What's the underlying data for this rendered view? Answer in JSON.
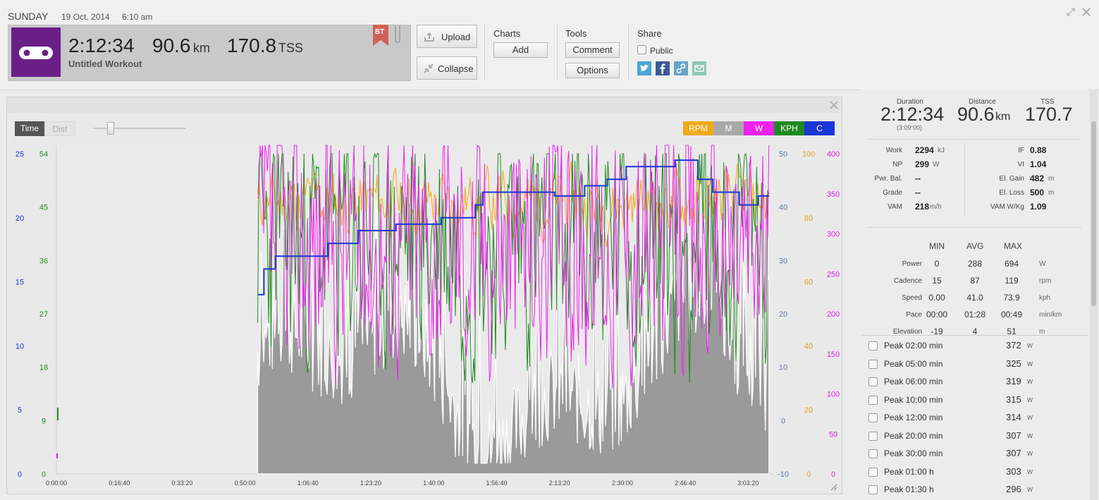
{
  "header": {
    "day": "SUNDAY",
    "date": "19 Oct, 2014",
    "time": "6:10 am",
    "duration": "2:12:34",
    "distance": "90.6",
    "distance_unit": "km",
    "tss": "170.8",
    "tss_unit": "TSS",
    "workout_title": "Untitled Workout",
    "bt_badge": "BT",
    "upload_label": "Upload",
    "collapse_label": "Collapse",
    "charts_title": "Charts",
    "add_label": "Add",
    "tools_title": "Tools",
    "comment_label": "Comment",
    "options_label": "Options",
    "share_title": "Share",
    "public_label": "Public",
    "share_icons": [
      "twitter-icon",
      "facebook-icon",
      "link-icon",
      "email-icon"
    ]
  },
  "chart": {
    "toggle_time": "Time",
    "toggle_dist": "Dist",
    "legend": [
      {
        "label": "RPM",
        "color": "#f2a818"
      },
      {
        "label": "M",
        "color": "#a9a9a9"
      },
      {
        "label": "W",
        "color": "#ee22ee"
      },
      {
        "label": "KPH",
        "color": "#1f8a1f"
      },
      {
        "label": "C",
        "color": "#1a36d6"
      }
    ],
    "x_ticks": [
      "0:00:00",
      "0:16:40",
      "0:33:20",
      "0:50:00",
      "1:06:40",
      "1:23:20",
      "1:40:00",
      "1:56:40",
      "2:13:20",
      "2:30:00",
      "2:46:40",
      "3:03:20"
    ],
    "axis_blue": [
      "25",
      "20",
      "15",
      "10",
      "5",
      "0"
    ],
    "axis_green": [
      "54",
      "45",
      "36",
      "27",
      "18",
      "9",
      "0"
    ],
    "axis_steel": [
      "50",
      "40",
      "30",
      "20",
      "10",
      "0",
      "-10"
    ],
    "axis_orange": [
      "100",
      "80",
      "60",
      "40",
      "20",
      "0"
    ],
    "axis_magenta": [
      "400",
      "350",
      "300",
      "250",
      "200",
      "150",
      "100",
      "50",
      "0"
    ]
  },
  "chart_data": {
    "type": "line",
    "x": [
      "0:00:00",
      "0:16:40",
      "0:33:20",
      "0:50:00",
      "1:06:40",
      "1:23:20",
      "1:40:00",
      "1:56:40",
      "2:13:20",
      "2:30:00",
      "2:46:40",
      "3:03:20"
    ],
    "series": [
      {
        "name": "RPM",
        "color": "#f2a818",
        "axis": "orange",
        "ylim": [
          0,
          100
        ]
      },
      {
        "name": "M",
        "color": "#a9a9a9",
        "axis": "steel",
        "ylim": [
          -10,
          50
        ]
      },
      {
        "name": "W",
        "color": "#ee22ee",
        "axis": "magenta",
        "ylim": [
          0,
          400
        ]
      },
      {
        "name": "KPH",
        "color": "#1f8a1f",
        "axis": "green",
        "ylim": [
          0,
          54
        ]
      },
      {
        "name": "C",
        "color": "#1a36d6",
        "axis": "blue",
        "ylim": [
          0,
          25
        ],
        "x": [
          "0:53:20",
          "0:55:00",
          "0:58:00",
          "1:05:00",
          "1:12:00",
          "1:20:00",
          "1:30:00",
          "1:42:00",
          "1:51:00",
          "1:53:00",
          "2:12:00",
          "2:20:00",
          "2:26:00",
          "2:31:00",
          "2:37:00",
          "2:44:00",
          "2:50:00",
          "2:54:00",
          "3:01:00",
          "3:06:00"
        ],
        "values": [
          14,
          16,
          17,
          17,
          18,
          19,
          19.5,
          20,
          21,
          22,
          21.7,
          22.5,
          23,
          24,
          24,
          24.5,
          23,
          22,
          21,
          21.7
        ]
      }
    ]
  },
  "stats": {
    "duration_label": "Duration",
    "duration": "2:12:34",
    "duration_sub": "(3:09:00)",
    "distance_label": "Distance",
    "distance": "90.6",
    "distance_unit": "km",
    "tss_label": "TSS",
    "tss": "170.7",
    "left_rows": [
      {
        "label": "Work",
        "value": "2294",
        "unit": "kJ"
      },
      {
        "label": "NP",
        "value": "299",
        "unit": "W"
      },
      {
        "label": "Pwr. Bal.",
        "value": "--",
        "unit": ""
      },
      {
        "label": "Grade",
        "value": "--",
        "unit": ""
      },
      {
        "label": "VAM",
        "value": "218",
        "unit": "m/h"
      }
    ],
    "right_rows": [
      {
        "label": "IF",
        "value": "0.88",
        "unit": ""
      },
      {
        "label": "VI",
        "value": "1.04",
        "unit": ""
      },
      {
        "label": "El. Gain",
        "value": "482",
        "unit": "m"
      },
      {
        "label": "El. Loss",
        "value": "500",
        "unit": "m"
      },
      {
        "label": "VAM W/Kg",
        "value": "1.09",
        "unit": ""
      }
    ],
    "table_headers": [
      "MIN",
      "AVG",
      "MAX"
    ],
    "table_rows": [
      {
        "label": "Power",
        "min": "0",
        "avg": "288",
        "max": "694",
        "unit": "W"
      },
      {
        "label": "Cadence",
        "min": "15",
        "avg": "87",
        "max": "119",
        "unit": "rpm"
      },
      {
        "label": "Speed",
        "min": "0.00",
        "avg": "41.0",
        "max": "73.9",
        "unit": "kph"
      },
      {
        "label": "Pace",
        "min": "00:00",
        "avg": "01:28",
        "max": "00:49",
        "unit": "min/km"
      },
      {
        "label": "Elevation",
        "min": "-19",
        "avg": "4",
        "max": "51",
        "unit": "m"
      }
    ],
    "peaks": [
      {
        "label": "Peak 02:00 min",
        "value": "372",
        "unit": "w"
      },
      {
        "label": "Peak 05:00 min",
        "value": "325",
        "unit": "w"
      },
      {
        "label": "Peak 06:00 min",
        "value": "319",
        "unit": "w"
      },
      {
        "label": "Peak 10:00 min",
        "value": "315",
        "unit": "w"
      },
      {
        "label": "Peak 12:00 min",
        "value": "314",
        "unit": "w"
      },
      {
        "label": "Peak 20:00 min",
        "value": "307",
        "unit": "w"
      },
      {
        "label": "Peak 30:00 min",
        "value": "307",
        "unit": "w"
      },
      {
        "label": "Peak 01:00 h",
        "value": "303",
        "unit": "w"
      },
      {
        "label": "Peak 01:30 h",
        "value": "296",
        "unit": "w"
      }
    ]
  }
}
